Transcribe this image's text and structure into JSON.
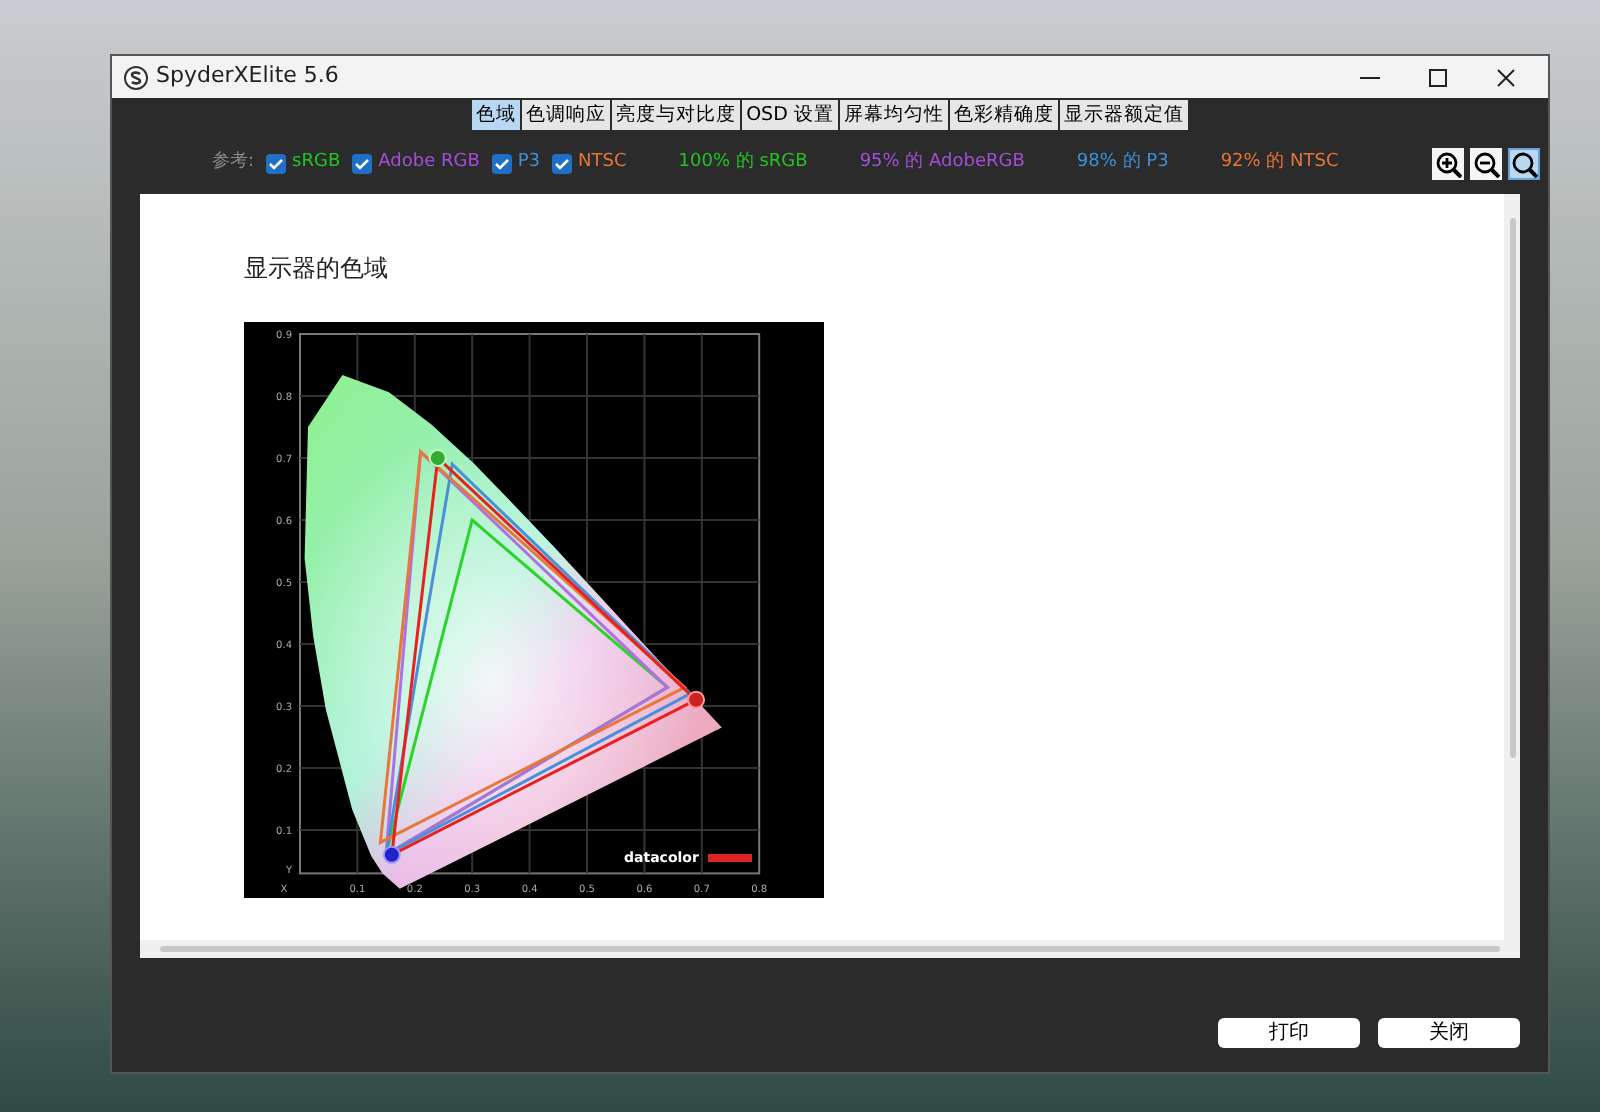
{
  "window": {
    "title": "SpyderXElite 5.6"
  },
  "tabs": [
    {
      "label": "色域",
      "selected": true
    },
    {
      "label": "色调响应",
      "selected": false
    },
    {
      "label": "亮度与对比度",
      "selected": false
    },
    {
      "label": "OSD 设置",
      "selected": false
    },
    {
      "label": "屏幕均匀性",
      "selected": false
    },
    {
      "label": "色彩精确度",
      "selected": false
    },
    {
      "label": "显示器额定值",
      "selected": false
    }
  ],
  "reference": {
    "label": "参考:",
    "items": [
      {
        "label": "sRGB",
        "checked": true,
        "color": "#22c322"
      },
      {
        "label": "Adobe RGB",
        "checked": true,
        "color": "#a14fd8"
      },
      {
        "label": "P3",
        "checked": true,
        "color": "#3d8fd6"
      },
      {
        "label": "NTSC",
        "checked": true,
        "color": "#e8733a"
      }
    ]
  },
  "coverage": [
    {
      "text": "100% 的 sRGB",
      "color": "#22c322"
    },
    {
      "text": "95% 的 AdobeRGB",
      "color": "#a14fd8"
    },
    {
      "text": "98% 的 P3",
      "color": "#3d8fd6"
    },
    {
      "text": "92% 的 NTSC",
      "color": "#e8733a"
    }
  ],
  "zoom_tools": [
    {
      "kind": "zoom_in",
      "selected": false
    },
    {
      "kind": "zoom_out",
      "selected": false
    },
    {
      "kind": "zoom",
      "selected": true
    }
  ],
  "report": {
    "title": "显示器的色域",
    "chart": {
      "x_tick_labels": [
        "X",
        "0.1",
        "0.2",
        "0.3",
        "0.4",
        "0.5",
        "0.6",
        "0.7",
        "0.8"
      ],
      "y_tick_labels": [
        "0.9",
        "0.8",
        "0.7",
        "0.6",
        "0.5",
        "0.4",
        "0.3",
        "0.2",
        "0.1",
        "Y"
      ],
      "logo": "datacolor"
    }
  },
  "buttons": [
    "打印",
    "关闭"
  ]
}
